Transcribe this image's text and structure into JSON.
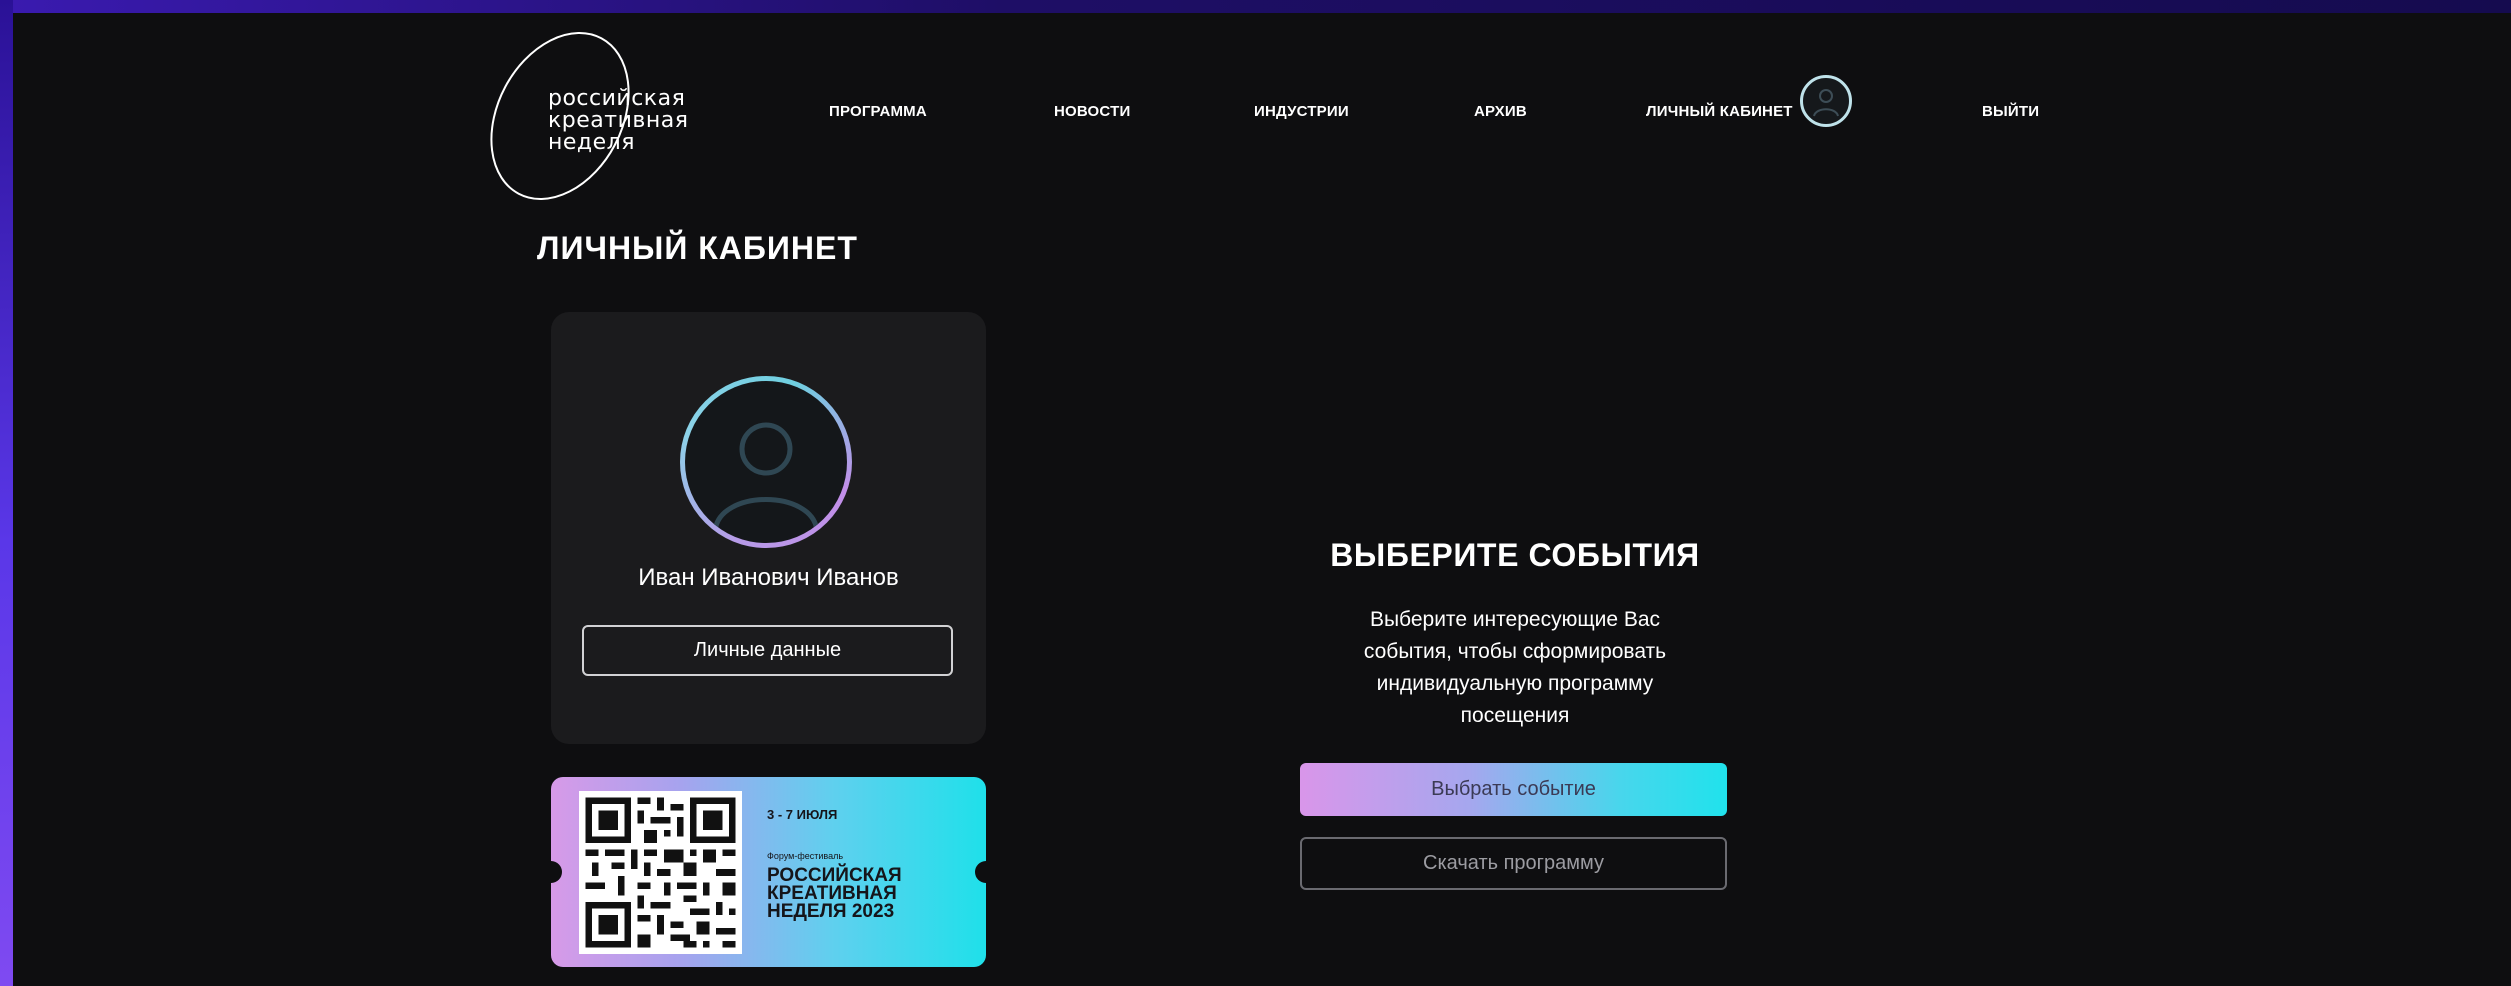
{
  "logo": {
    "lines": [
      "российская",
      "креативная",
      "неделя"
    ]
  },
  "nav": {
    "items": [
      {
        "label": "ПРОГРАММА"
      },
      {
        "label": "НОВОСТИ"
      },
      {
        "label": "ИНДУСТРИИ"
      },
      {
        "label": "АРХИВ"
      },
      {
        "label": "ЛИЧНЫЙ КАБИНЕТ"
      },
      {
        "label": "ВЫЙТИ"
      }
    ],
    "avatar_icon": "user-icon"
  },
  "page": {
    "title": "ЛИЧНЫЙ КАБИНЕТ"
  },
  "profile": {
    "name": "Иван Иванович Иванов",
    "personal_data_label": "Личные данные",
    "avatar_icon": "user-icon"
  },
  "ticket": {
    "date": "3 - 7 ИЮЛЯ",
    "subtitle": "Форум-фестиваль",
    "name_lines": [
      "РОССИЙСКАЯ",
      "КРЕАТИВНАЯ",
      "НЕДЕЛЯ 2023"
    ],
    "qr_icon": "qr-code-icon"
  },
  "events": {
    "title": "ВЫБЕРИТЕ СОБЫТИЯ",
    "description_lines": [
      "Выберите интересующие Вас",
      "события, чтобы сформировать",
      "индивидуальную программу",
      "посещения"
    ],
    "choose_label": "Выбрать событие",
    "download_label": "Скачать программу"
  },
  "colors": {
    "background": "#0e0e10",
    "frame": "#24108a",
    "card": "#1b1b1d",
    "accent_pink": "#d996ea",
    "accent_cyan": "#20e2ec"
  }
}
